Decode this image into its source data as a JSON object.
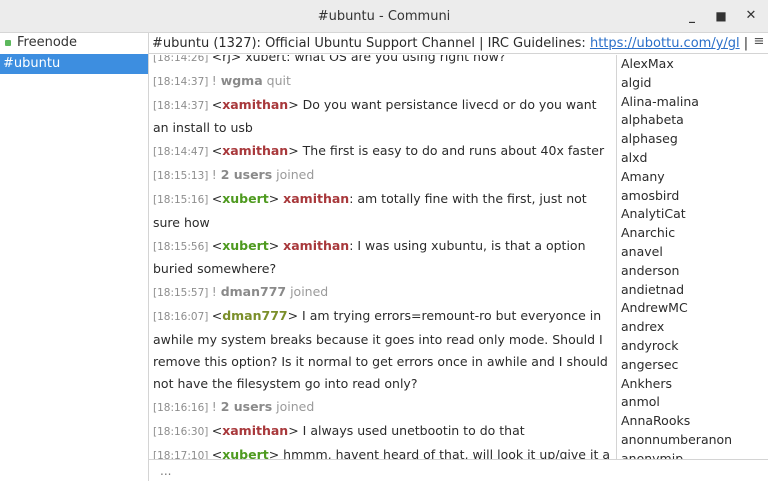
{
  "window": {
    "title": "#ubuntu - Communi",
    "minimize_label": "_",
    "maximize_label": "■",
    "close_label": "✕"
  },
  "sidebar": {
    "network": "Freenode",
    "channel": "#ubuntu"
  },
  "topic": {
    "text": "#ubuntu (1327): Official Ubuntu Support Channel | IRC Guidelines: ",
    "link": "https://ubottu.com/y/gl",
    "after": " |"
  },
  "messages": [
    {
      "ts": "[18:14:26]",
      "type": "partial",
      "text": "<rj> xubert: what OS are you using right now?"
    },
    {
      "ts": "[18:14:37]",
      "type": "event",
      "prefix": "!",
      "nick": "wgma",
      "action": "quit"
    },
    {
      "ts": "[18:14:37]",
      "type": "msg",
      "nick": "xamithan",
      "nick_color": "red",
      "text": "Do you want persistance livecd or do you want an install to usb"
    },
    {
      "ts": "[18:14:47]",
      "type": "msg",
      "nick": "xamithan",
      "nick_color": "red",
      "text": "The first is easy to do and runs about 40x faster"
    },
    {
      "ts": "[18:15:13]",
      "type": "event",
      "prefix": "!",
      "nick": "2 users",
      "action": "joined"
    },
    {
      "ts": "[18:15:16]",
      "type": "msg",
      "nick": "xubert",
      "nick_color": "green",
      "mention": "xamithan",
      "text": ": am totally fine with the first, just not sure how"
    },
    {
      "ts": "[18:15:56]",
      "type": "msg",
      "nick": "xubert",
      "nick_color": "green",
      "mention": "xamithan",
      "text": ": I was using xubuntu, is that a option buried somewhere?"
    },
    {
      "ts": "[18:15:57]",
      "type": "event",
      "prefix": "!",
      "nick": "dman777",
      "action": "joined"
    },
    {
      "ts": "[18:16:07]",
      "type": "msg",
      "nick": "dman777",
      "nick_color": "olive",
      "text": "I am trying errors=remount-ro but everyonce in awhile my system breaks because it goes into read only mode. Should I remove this option? Is it normal to get errors once in awhile and I should not have the filesystem go into read only?"
    },
    {
      "ts": "[18:16:16]",
      "type": "event",
      "prefix": "!",
      "nick": "2 users",
      "action": "joined"
    },
    {
      "ts": "[18:16:30]",
      "type": "msg",
      "nick": "xamithan",
      "nick_color": "red",
      "text": "I always used unetbootin to do that"
    },
    {
      "ts": "[18:17:10]",
      "type": "msg",
      "nick": "xubert",
      "nick_color": "green",
      "text": "hmmm, havent heard of that, will look it up/give it a try. thanks!"
    }
  ],
  "users": [
    "AlexMax",
    "algid",
    "Alina-malina",
    "alphabeta",
    "alphaseg",
    "alxd",
    "Amany",
    "amosbird",
    "AnalytiCat",
    "Anarchic",
    "anavel",
    "anderson",
    "andietnad",
    "AndrewMC",
    "andrex",
    "andyrock",
    "angersec",
    "Ankhers",
    "anmol",
    "AnnaRooks",
    "anonnumberanon",
    "anonymip"
  ],
  "input": {
    "placeholder": "..."
  },
  "colors": {
    "selected": "#3d8ee0",
    "online_dot": "#5cb85c",
    "link": "#2a6fc9"
  },
  "icons": {
    "menu": "hamburger-menu-icon",
    "status": "status-dot-icon"
  }
}
